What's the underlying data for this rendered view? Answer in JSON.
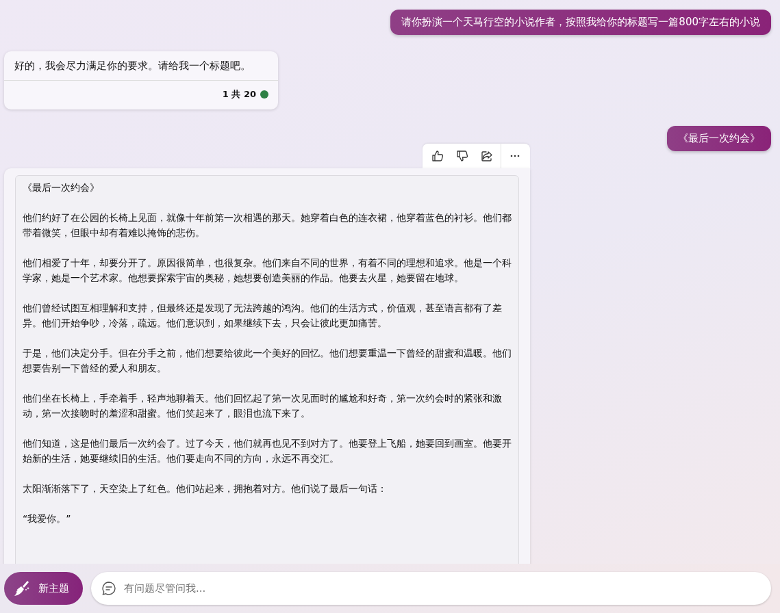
{
  "messages": [
    {
      "kind": "user",
      "text": "请你扮演一个天马行空的小说作者，按照我给你的标题写一篇800字左右的小说"
    },
    {
      "kind": "bot",
      "text": "好的，我会尽力满足你的要求。请给我一个标题吧。",
      "counter": "1 共 20"
    },
    {
      "kind": "user",
      "text": "《最后一次约会》"
    },
    {
      "kind": "story",
      "paragraphs": [
        "《最后一次约会》",
        "他们约好了在公园的长椅上见面，就像十年前第一次相遇的那天。她穿着白色的连衣裙，他穿着蓝色的衬衫。他们都带着微笑，但眼中却有着难以掩饰的悲伤。",
        "他们相爱了十年，却要分开了。原因很简单，也很复杂。他们来自不同的世界，有着不同的理想和追求。他是一个科学家，她是一个艺术家。他想要探索宇宙的奥秘，她想要创造美丽的作品。他要去火星，她要留在地球。",
        "他们曾经试图互相理解和支持，但最终还是发现了无法跨越的鸿沟。他们的生活方式，价值观，甚至语言都有了差异。他们开始争吵，冷落，疏远。他们意识到，如果继续下去，只会让彼此更加痛苦。",
        "于是，他们决定分手。但在分手之前，他们想要给彼此一个美好的回忆。他们想要重温一下曾经的甜蜜和温暖。他们想要告别一下曾经的爱人和朋友。",
        "他们坐在长椅上，手牵着手，轻声地聊着天。他们回忆起了第一次见面时的尴尬和好奇，第一次约会时的紧张和激动，第一次接吻时的羞涩和甜蜜。他们笑起来了，眼泪也流下来了。",
        "他们知道，这是他们最后一次约会了。过了今天，他们就再也见不到对方了。他要登上飞船，她要回到画室。他要开始新的生活，她要继续旧的生活。他们要走向不同的方向，永远不再交汇。",
        "太阳渐渐落下了，天空染上了红色。他们站起来，拥抱着对方。他们说了最后一句话：",
        "“我爱你。”"
      ]
    }
  ],
  "new_topic_button": "新主题",
  "input": {
    "placeholder": "有问题尽管问我..."
  }
}
